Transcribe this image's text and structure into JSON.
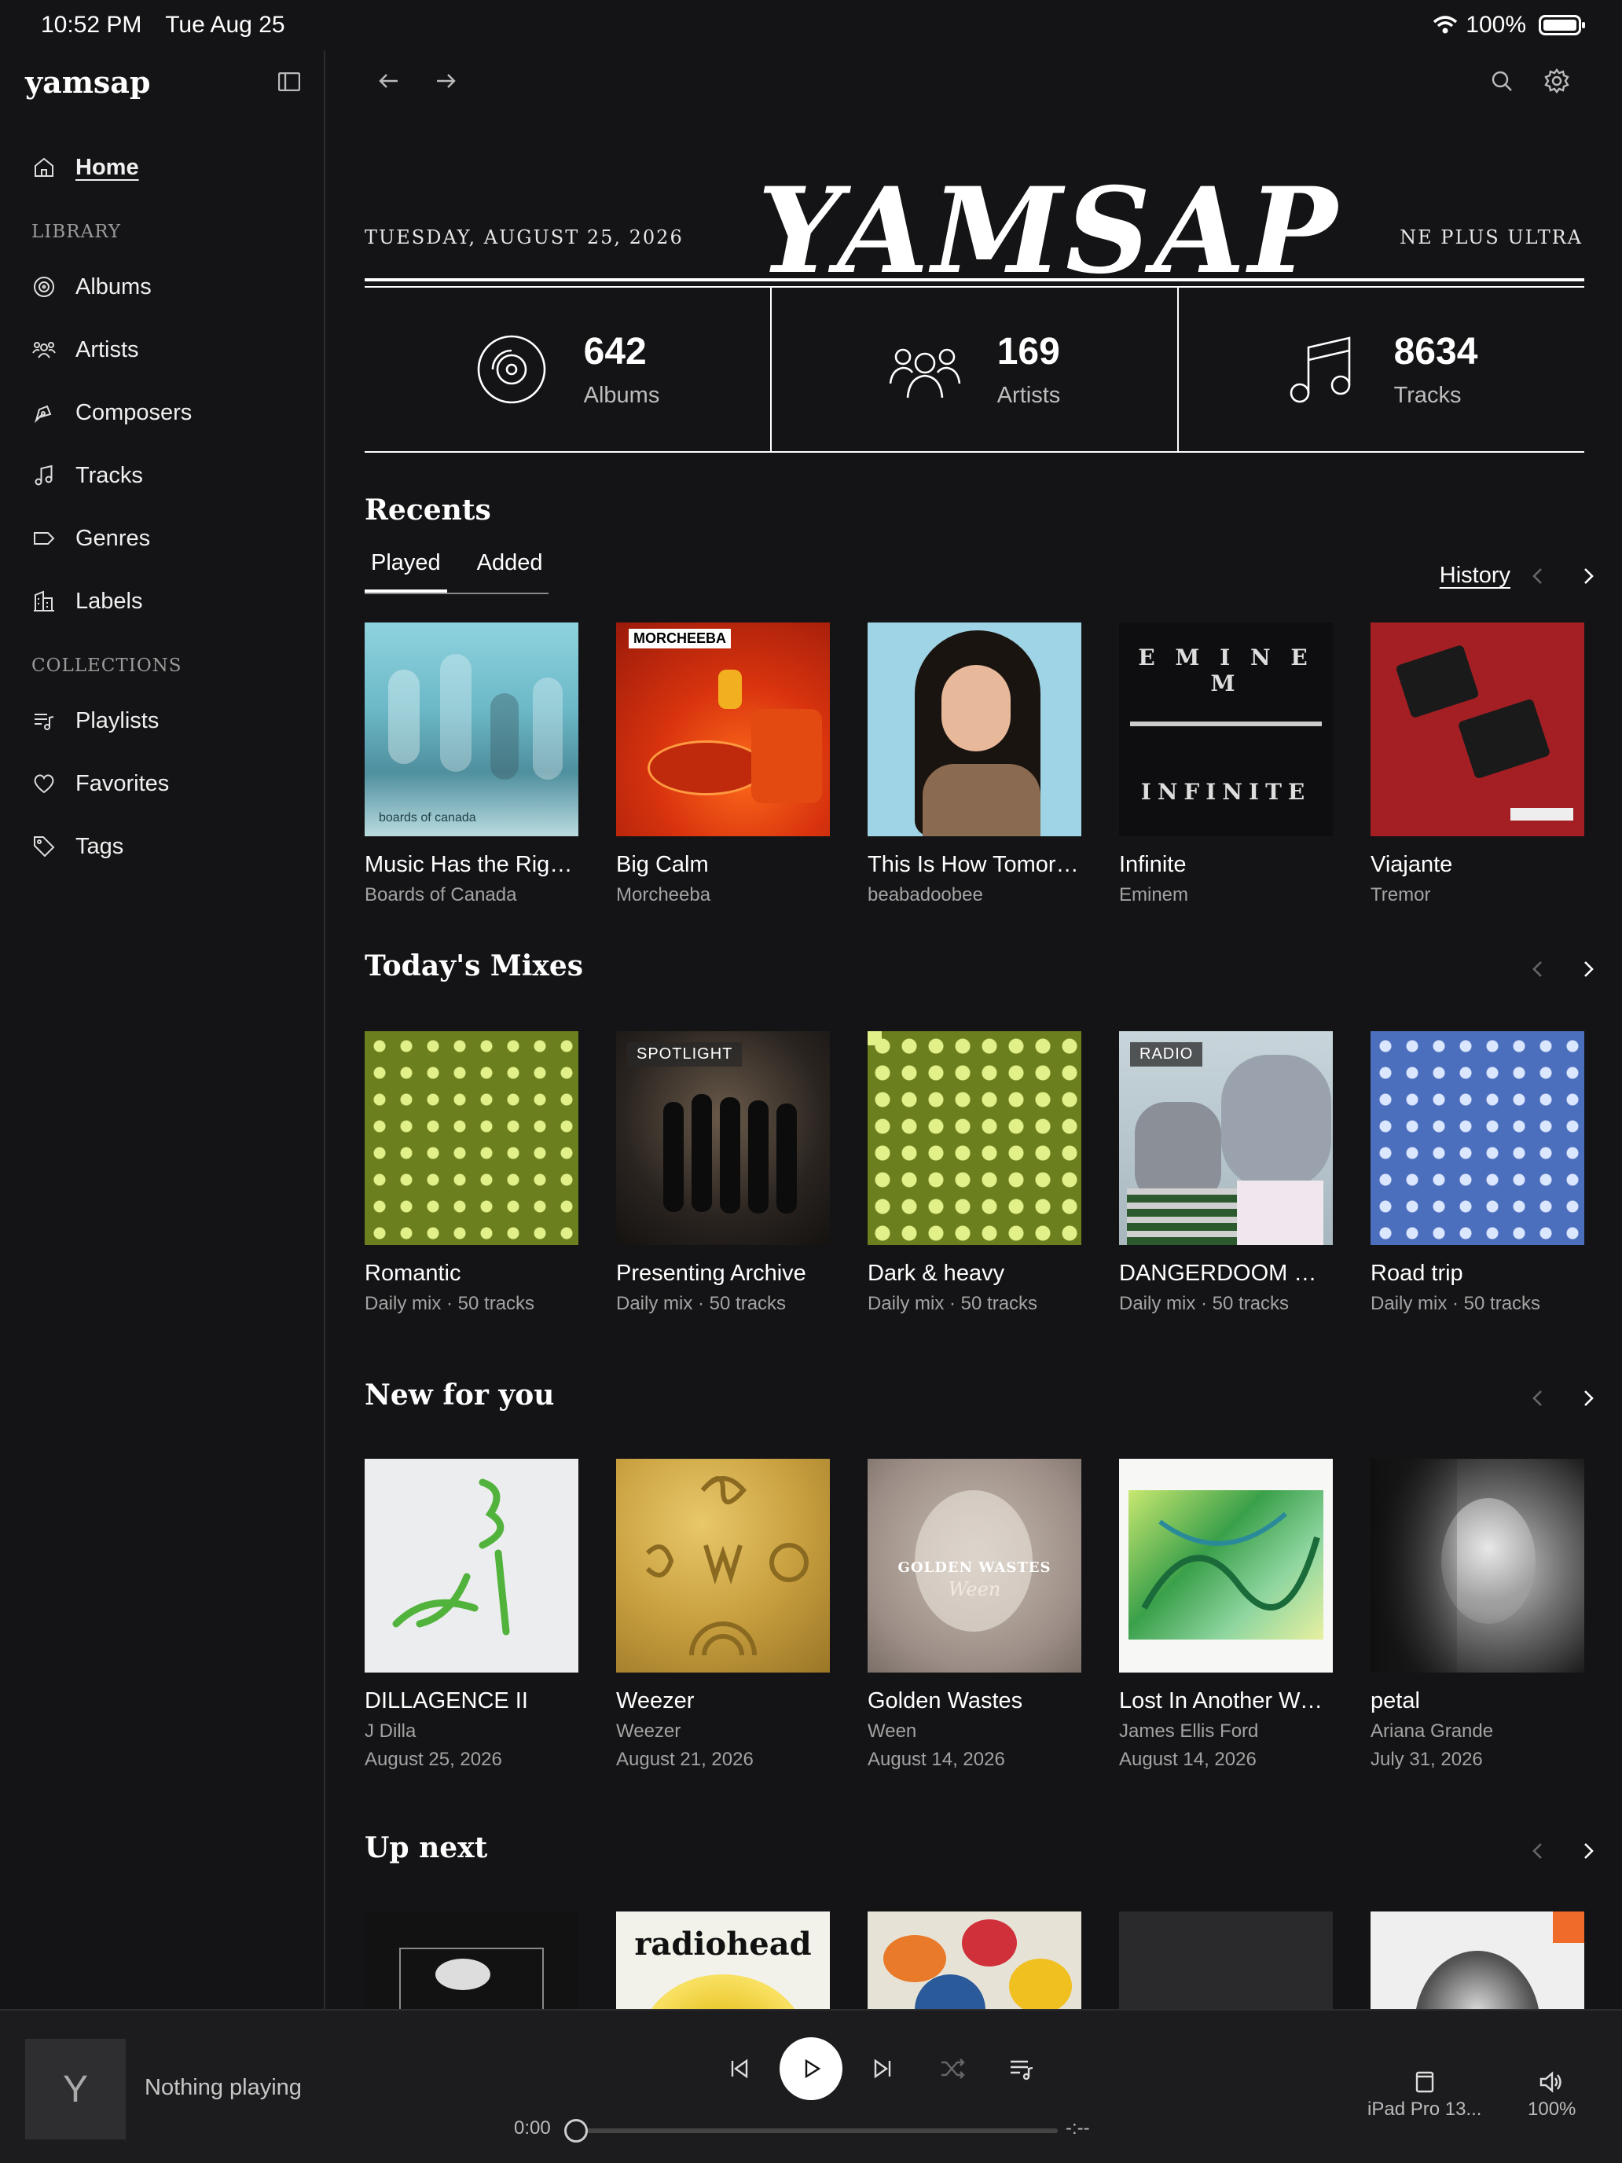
{
  "status": {
    "time": "10:52 PM",
    "date": "Tue Aug 25",
    "battery": "100%"
  },
  "sidebar": {
    "brand": "yamsap",
    "home": "Home",
    "library_header": "LIBRARY",
    "library": [
      "Albums",
      "Artists",
      "Composers",
      "Tracks",
      "Genres",
      "Labels"
    ],
    "collections_header": "COLLECTIONS",
    "collections": [
      "Playlists",
      "Favorites",
      "Tags"
    ]
  },
  "masthead": {
    "date": "TUESDAY, AUGUST 25, 2026",
    "logo": "YAMSAP",
    "tagline": "NE PLUS ULTRA"
  },
  "stats": [
    {
      "value": "642",
      "label": "Albums",
      "icon": "disc-icon"
    },
    {
      "value": "169",
      "label": "Artists",
      "icon": "users-icon"
    },
    {
      "value": "8634",
      "label": "Tracks",
      "icon": "music-note-icon"
    }
  ],
  "recents": {
    "title": "Recents",
    "tabs": [
      "Played",
      "Added"
    ],
    "history": "History",
    "items": [
      {
        "title": "Music Has the Righ…",
        "sub": "Boards of Canada"
      },
      {
        "title": "Big Calm",
        "sub": "Morcheeba"
      },
      {
        "title": "This Is How Tomorr…",
        "sub": "beabadoobee"
      },
      {
        "title": "Infinite",
        "sub": "Eminem"
      },
      {
        "title": "Viajante",
        "sub": "Tremor"
      }
    ]
  },
  "mixes": {
    "title": "Today's Mixes",
    "items": [
      {
        "title": "Romantic",
        "sub": "Daily mix · 50 tracks",
        "badge": ""
      },
      {
        "title": "Presenting Archive",
        "sub": "Daily mix · 50 tracks",
        "badge": "SPOTLIGHT"
      },
      {
        "title": "Dark & heavy",
        "sub": "Daily mix · 50 tracks",
        "badge": ""
      },
      {
        "title": "DANGERDOOM R…",
        "sub": "Daily mix · 50 tracks",
        "badge": "RADIO"
      },
      {
        "title": "Road trip",
        "sub": "Daily mix · 50 tracks",
        "badge": ""
      }
    ]
  },
  "new_for_you": {
    "title": "New for you",
    "items": [
      {
        "title": "DILLAGENCE II",
        "sub": "J Dilla",
        "date": "August 25, 2026"
      },
      {
        "title": "Weezer",
        "sub": "Weezer",
        "date": "August 21, 2026"
      },
      {
        "title": "Golden Wastes",
        "sub": "Ween",
        "date": "August 14, 2026"
      },
      {
        "title": "Lost In Another World",
        "sub": "James Ellis Ford",
        "date": "August 14, 2026"
      },
      {
        "title": "petal",
        "sub": "Ariana Grande",
        "date": "July 31, 2026"
      }
    ]
  },
  "up_next": {
    "title": "Up next"
  },
  "art_text": {
    "eminem_top": "E M I N E M",
    "eminem_bottom": "INFINITE",
    "morcheeba": "MORCHEEBA",
    "golden": "GOLDEN WASTES",
    "ween": "Ween",
    "radiohead": "radiohead",
    "bots": "boards of canada"
  },
  "player": {
    "thumb_letter": "Y",
    "status": "Nothing playing",
    "elapsed": "0:00",
    "remaining": "-:--",
    "device": "iPad Pro 13...",
    "volume": "100%"
  }
}
